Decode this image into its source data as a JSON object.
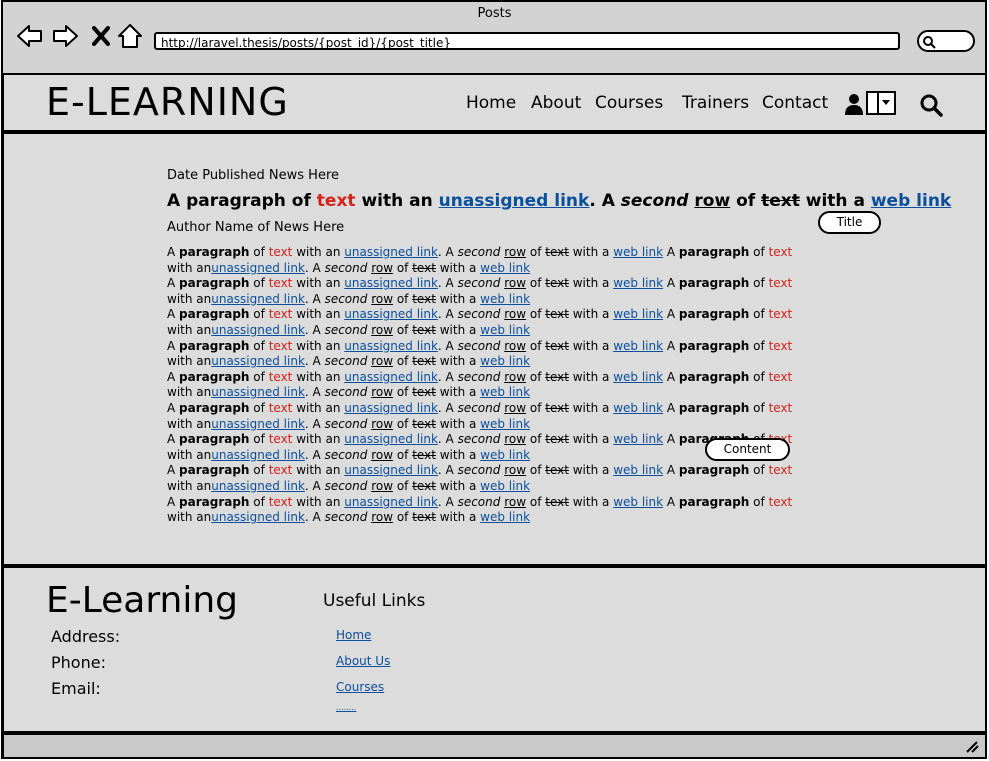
{
  "browser": {
    "window_title": "Posts",
    "url": "http://laravel.thesis/posts/{post_id}/{post_title}"
  },
  "header": {
    "logo": "E-LEARNING",
    "nav": [
      "Home",
      "About",
      "Courses",
      "Trainers",
      "Contact"
    ]
  },
  "post": {
    "date": "Date Published News Here",
    "title_parts": [
      "A paragraph of ",
      "text",
      " with an ",
      "unassigned link",
      ". A ",
      "second",
      " ",
      "row",
      " of ",
      "text",
      " with a ",
      "web link"
    ],
    "author": "Author Name of News Here",
    "line1": {
      "a": "A ",
      "paragraph": "paragraph",
      "of": " of ",
      "text": "text",
      "with_an": " with an ",
      "unassigned": "unassigned link",
      "dot_a": ". A ",
      "second": "second",
      "sp": " ",
      "row": "row",
      "of2": " of ",
      "text2": "text",
      "with_a": " with a ",
      "web": "web link",
      "sp2": " "
    },
    "line2": {
      "a": "A ",
      "paragraph": "paragraph",
      "of": " of ",
      "text": "text",
      "with_an": " with an",
      "unassigned": "unassigned link",
      "dot_a": ". A ",
      "second": "second",
      "sp": " ",
      "row": "row",
      "of2": " of ",
      "text2": "text",
      "with_a": " with a ",
      "web": "web link"
    }
  },
  "callouts": {
    "title": "Title",
    "content": "Content"
  },
  "footer": {
    "logo": "E-Learning",
    "labels": [
      "Address:",
      "Phone:",
      "Email:"
    ],
    "useful_title": "Useful Links",
    "links": [
      "Home",
      "About Us",
      "Courses",
      "........"
    ]
  }
}
